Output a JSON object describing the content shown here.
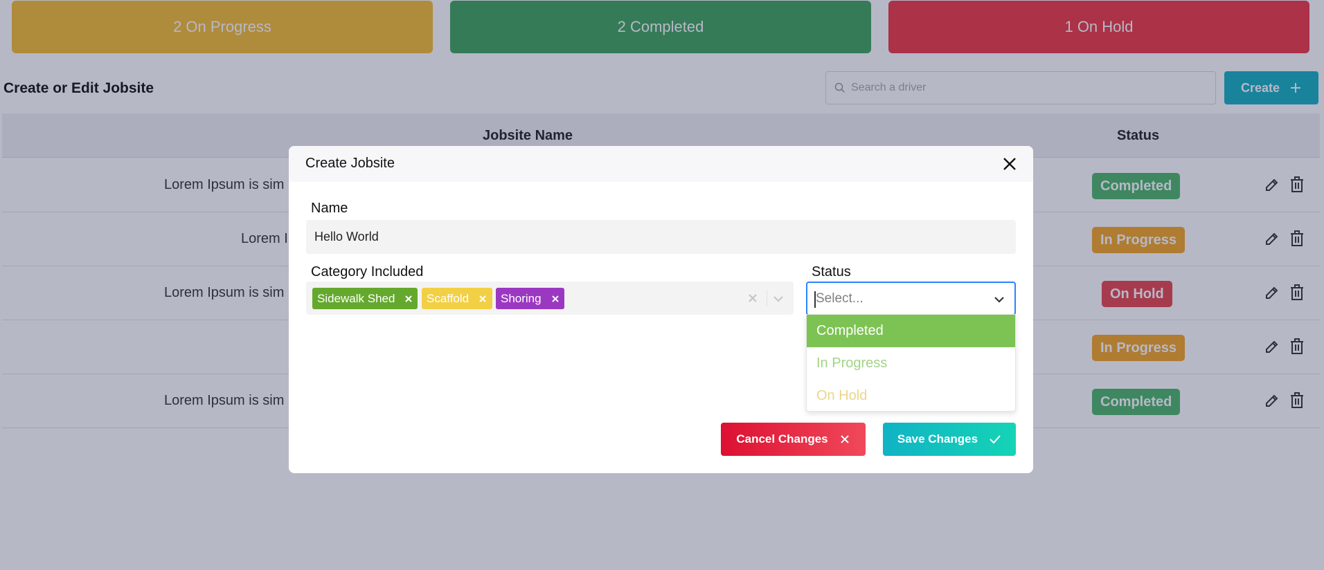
{
  "summary": {
    "on_progress": "2 On Progress",
    "completed": "2 Completed",
    "on_hold": "1 On Hold"
  },
  "page": {
    "title": "Create or Edit Jobsite",
    "search_placeholder": "Search a driver",
    "create_label": "Create"
  },
  "table": {
    "columns": [
      "Jobsite Name",
      "Status"
    ],
    "rows": [
      {
        "name": "Lorem Ipsum is sim",
        "status": "Completed"
      },
      {
        "name": "Lorem I",
        "status": "In Progress"
      },
      {
        "name": "Lorem Ipsum is sim",
        "status": "On Hold"
      },
      {
        "name": "",
        "status": "In Progress"
      },
      {
        "name": "Lorem Ipsum is sim",
        "status": "Completed"
      }
    ]
  },
  "modal": {
    "title": "Create Jobsite",
    "name_label": "Name",
    "name_value": "Hello World",
    "category_label": "Category Included",
    "categories": [
      "Sidewalk Shed",
      "Scaffold",
      "Shoring"
    ],
    "status_label": "Status",
    "status_placeholder": "Select...",
    "status_options": [
      "Completed",
      "In Progress",
      "On Hold"
    ],
    "cancel_label": "Cancel Changes",
    "save_label": "Save Changes"
  },
  "colors": {
    "on_progress": "#f5bd32",
    "completed": "#3fa55a",
    "on_hold": "#ef3842",
    "accent": "#16b0c0",
    "focus": "#2684ff"
  },
  "icons": [
    "search-icon",
    "plus-icon",
    "edit-icon",
    "trash-icon",
    "close-icon",
    "chevron-down-icon",
    "check-icon"
  ]
}
